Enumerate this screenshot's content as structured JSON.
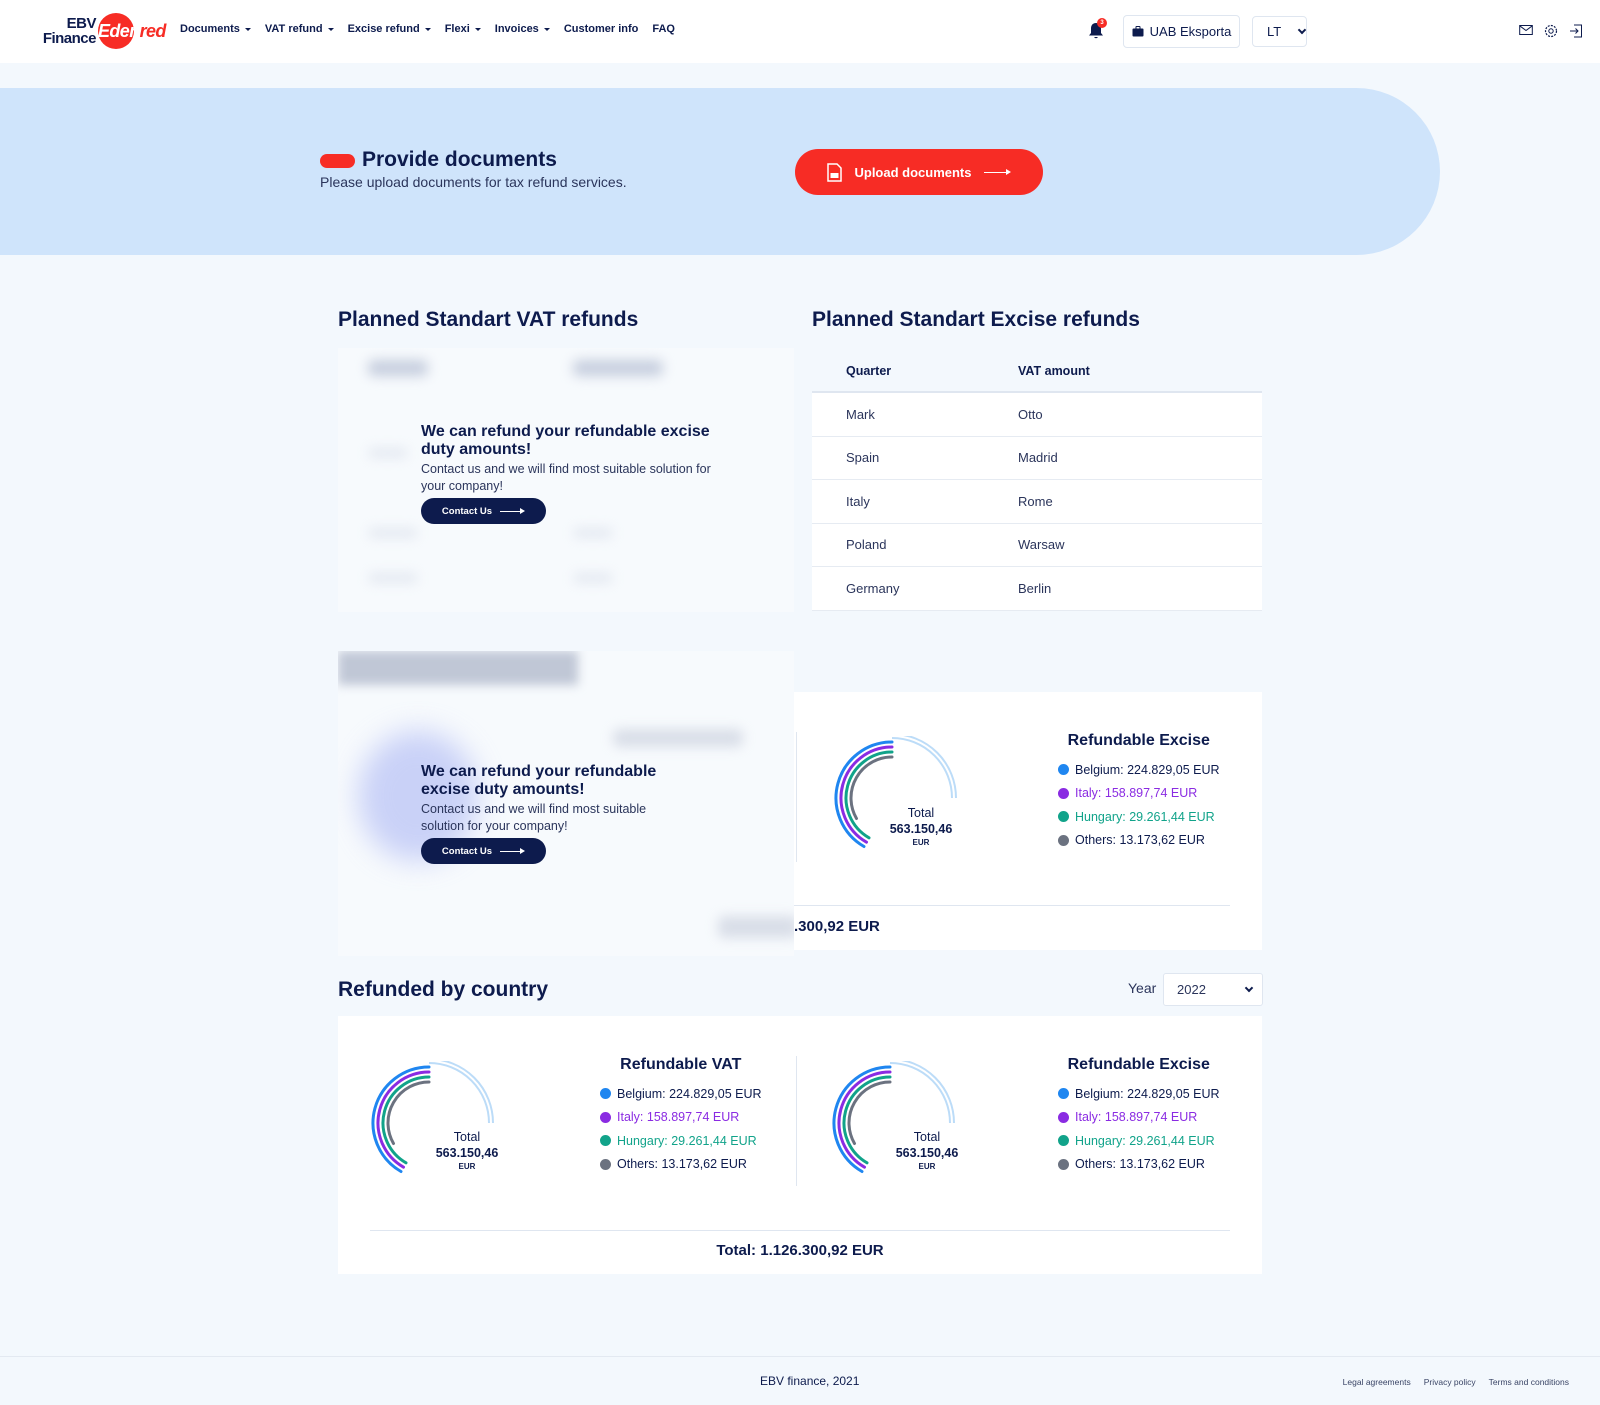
{
  "header": {
    "logo_top": "EBV",
    "logo_bottom": "Finance",
    "logo_brand_a": "Eden",
    "logo_brand_b": "red",
    "nav": [
      {
        "label": "Documents",
        "dropdown": true
      },
      {
        "label": "VAT refund",
        "dropdown": true
      },
      {
        "label": "Excise refund",
        "dropdown": true
      },
      {
        "label": "Flexi",
        "dropdown": true
      },
      {
        "label": "Invoices",
        "dropdown": true
      },
      {
        "label": "Customer info",
        "dropdown": false
      },
      {
        "label": "FAQ",
        "dropdown": false
      }
    ],
    "notification_count": "3",
    "company": "UAB Eksporta",
    "language": "LT"
  },
  "banner": {
    "title": "Provide documents",
    "subtitle": "Please upload documents for tax refund services.",
    "upload_label": "Upload documents"
  },
  "vat_refunds": {
    "title": "Planned Standart VAT refunds",
    "promo_title": "We can refund your refundable excise duty amounts!",
    "promo_text": "Contact us and we will find most suitable solution for your company!",
    "contact_label": "Contact Us"
  },
  "excise_refunds": {
    "title": "Planned Standart Excise refunds",
    "columns": [
      "Quarter",
      "VAT amount"
    ],
    "rows": [
      [
        "Mark",
        "Otto"
      ],
      [
        "Spain",
        "Madrid"
      ],
      [
        "Italy",
        "Rome"
      ],
      [
        "Poland",
        "Warsaw"
      ],
      [
        "Germany",
        "Berlin"
      ]
    ]
  },
  "middle": {
    "promo_title": "We can refund your refundable excise duty amounts!",
    "promo_text": "Contact us and we will find most suitable solution for your company!",
    "contact_label": "Contact Us",
    "partial_total": ".300,92 EUR",
    "excise": {
      "title": "Refundable Excise",
      "total_label": "Total",
      "total_value": "563.150,46",
      "currency": "EUR"
    }
  },
  "by_country": {
    "title": "Refunded by country",
    "year_label": "Year",
    "year_value": "2022",
    "vat_title": "Refundable VAT",
    "excise_title": "Refundable Excise",
    "total_label": "Total",
    "total_value": "563.150,46",
    "currency": "EUR",
    "grand_total": "Total: 1.126.300,92 EUR"
  },
  "legend": [
    {
      "label": "Belgium: 224.829,05 EUR",
      "color": "#1f86f0",
      "text_color": "#0d1b4d"
    },
    {
      "label": "Italy: 158.897,74 EUR",
      "color": "#8a2be2",
      "text_color": "#8a2be2"
    },
    {
      "label": "Hungary: 29.261,44 EUR",
      "color": "#11a38a",
      "text_color": "#11a38a"
    },
    {
      "label": "Others: 13.173,62 EUR",
      "color": "#6b7280",
      "text_color": "#0d1b4d"
    }
  ],
  "footer": {
    "copyright": "EBV finance, 2021",
    "links": [
      "Legal agreements",
      "Privacy policy",
      "Terms and conditions"
    ]
  },
  "colors": {
    "brand_red": "#f72c25",
    "navy": "#0d1b4d",
    "banner_bg": "#cfe4fb"
  }
}
